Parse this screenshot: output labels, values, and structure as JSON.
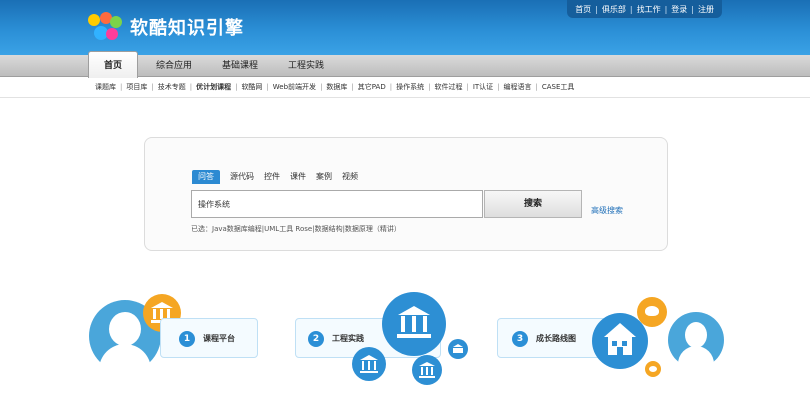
{
  "site": {
    "name": "软酷知识引擎"
  },
  "top_links": [
    "首页",
    "俱乐部",
    "找工作",
    "登录",
    "注册"
  ],
  "nav_tabs": [
    {
      "label": "首页",
      "active": true
    },
    {
      "label": "综合应用",
      "active": false
    },
    {
      "label": "基础课程",
      "active": false
    },
    {
      "label": "工程实践",
      "active": false
    }
  ],
  "subnav": [
    {
      "label": "课题库",
      "bold": false
    },
    {
      "label": "项目库",
      "bold": false
    },
    {
      "label": "技术专题",
      "bold": false
    },
    {
      "label": "优计划课程",
      "bold": true
    },
    {
      "label": "软酷网",
      "bold": false
    },
    {
      "label": "Web前端开发",
      "bold": false
    },
    {
      "label": "数据库",
      "bold": false
    },
    {
      "label": "其它PAD",
      "bold": false
    },
    {
      "label": "操作系统",
      "bold": false
    },
    {
      "label": "软件过程",
      "bold": false
    },
    {
      "label": "IT认证",
      "bold": false
    },
    {
      "label": "编程语言",
      "bold": false
    },
    {
      "label": "CASE工具",
      "bold": false
    }
  ],
  "search": {
    "tabs": [
      "问答",
      "源代码",
      "控件",
      "课件",
      "案例",
      "视频"
    ],
    "active_tab": "问答",
    "value": "操作系统",
    "button_label": "搜索",
    "advanced_label": "高级搜索",
    "selected_text": "已选：Java数据库编程|UML工具 Rose|数据结构|数据原理（精讲）"
  },
  "features": [
    {
      "num": "1",
      "label": "课程平台"
    },
    {
      "num": "2",
      "label": "工程实践"
    },
    {
      "num": "3",
      "label": "成长路线图"
    }
  ],
  "colors": {
    "header": "#2b8fd6",
    "accent": "#2c8ad2",
    "orange": "#f5a623",
    "link": "#1f6fb8"
  }
}
